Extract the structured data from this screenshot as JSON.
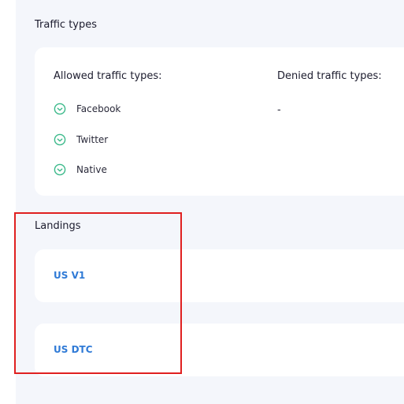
{
  "traffic_types": {
    "title": "Traffic types",
    "allowed_heading": "Allowed traffic types:",
    "denied_heading": "Denied traffic types:",
    "allowed": [
      {
        "label": "Facebook",
        "icon": "check-circle-icon"
      },
      {
        "label": "Twitter",
        "icon": "check-circle-icon"
      },
      {
        "label": "Native",
        "icon": "check-circle-icon"
      }
    ],
    "denied_value": "-"
  },
  "landings": {
    "title": "Landings",
    "items": [
      {
        "label": "US V1"
      },
      {
        "label": "US DTC"
      }
    ]
  },
  "colors": {
    "accent_green": "#3bb98a",
    "link_blue": "#2f7ad6",
    "highlight_red": "#e02020",
    "panel_bg": "#f4f6fb"
  }
}
